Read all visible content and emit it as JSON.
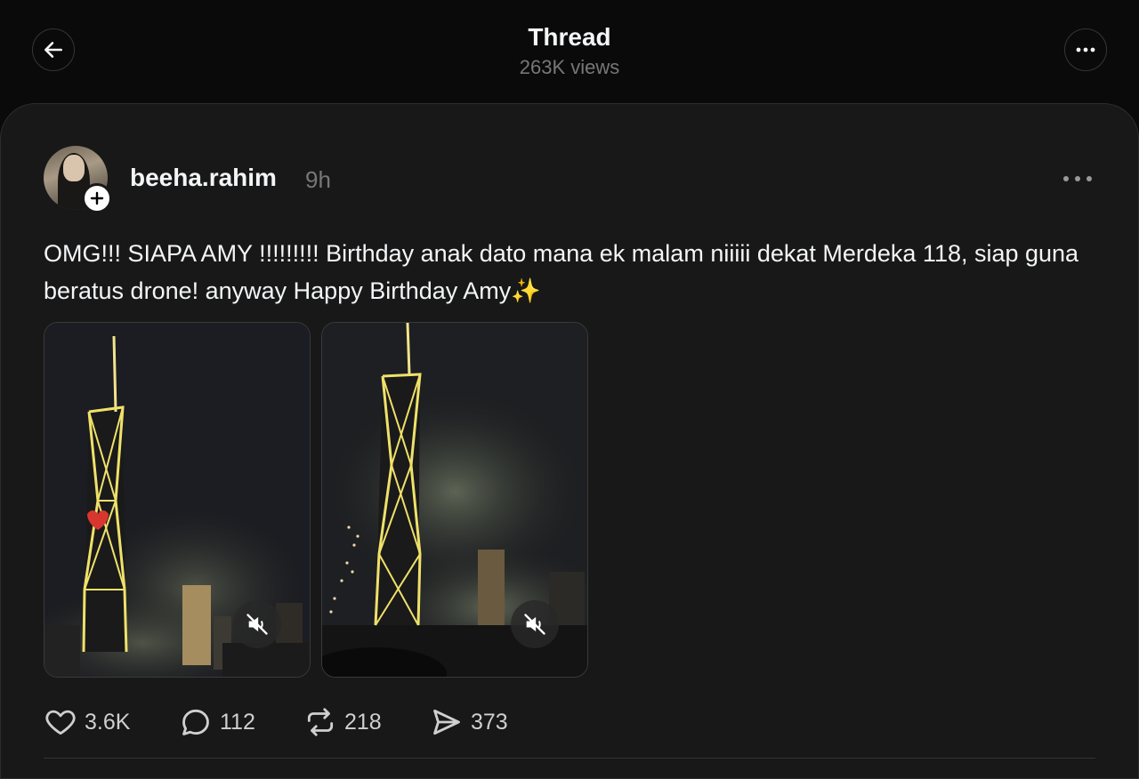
{
  "header": {
    "title": "Thread",
    "views": "263K views",
    "back_icon": "arrow-left-icon",
    "more_icon": "ellipsis-icon"
  },
  "post": {
    "username": "beeha.rahim",
    "time_ago": "9h",
    "text": "OMG!!! SIAPA AMY !!!!!!!!! Birthday anak dato mana ek malam niiiii dekat Merdeka 118, siap guna beratus drone! anyway Happy Birthday Amy✨",
    "media": [
      {
        "type": "video",
        "muted": true,
        "icon": "speaker-muted-icon"
      },
      {
        "type": "video",
        "muted": true,
        "icon": "speaker-muted-icon"
      }
    ],
    "actions": {
      "likes": "3.6K",
      "replies": "112",
      "reposts": "218",
      "shares": "373"
    }
  },
  "colors": {
    "background": "#0a0a0a",
    "card": "#181818",
    "text_primary": "#f3f5f7",
    "text_secondary": "#777777"
  }
}
